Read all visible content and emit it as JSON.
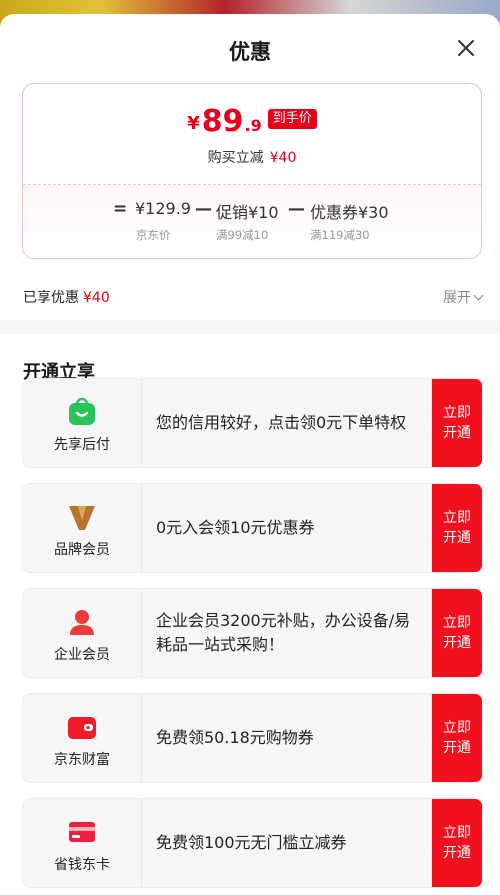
{
  "sheet": {
    "title": "优惠"
  },
  "price": {
    "currency": "¥",
    "integer": "89",
    "decimal": ".9",
    "tag": "到手价",
    "reduce_label": "购买立减",
    "reduce_amount": "¥40"
  },
  "formula": {
    "eq": "=",
    "jd_price": "¥129.9",
    "jd_price_caption": "京东价",
    "minus1": "—",
    "promo": "促销¥10",
    "promo_caption": "满99减10",
    "minus2": "—",
    "coupon": "优惠券¥30",
    "coupon_caption": "满119减30"
  },
  "enjoyed": {
    "label": "已享优惠",
    "amount": "¥40",
    "expand_label": "展开"
  },
  "section": {
    "title": "开通立享"
  },
  "benefits": [
    {
      "label": "先享后付",
      "desc": "您的信用较好，点击领0元下单特权",
      "button": "立即开通",
      "icon": "shopping-bag-icon"
    },
    {
      "label": "品牌会员",
      "desc": "0元入会领10元优惠券",
      "button": "立即开通",
      "icon": "brand-v-icon"
    },
    {
      "label": "企业会员",
      "desc": "企业会员3200元补贴，办公设备/易耗品一站式采购！",
      "button": "立即开通",
      "icon": "person-icon"
    },
    {
      "label": "京东财富",
      "desc": "免费领50.18元购物券",
      "button": "立即开通",
      "icon": "wallet-icon"
    },
    {
      "label": "省钱东卡",
      "desc": "免费领100元无门槛立减券",
      "button": "立即开通",
      "icon": "card-icon"
    }
  ],
  "colors": {
    "accent": "#e6001a",
    "button": "#f0101e",
    "bag_green": "#2bc25a",
    "brand_gold": "#b8742a"
  }
}
